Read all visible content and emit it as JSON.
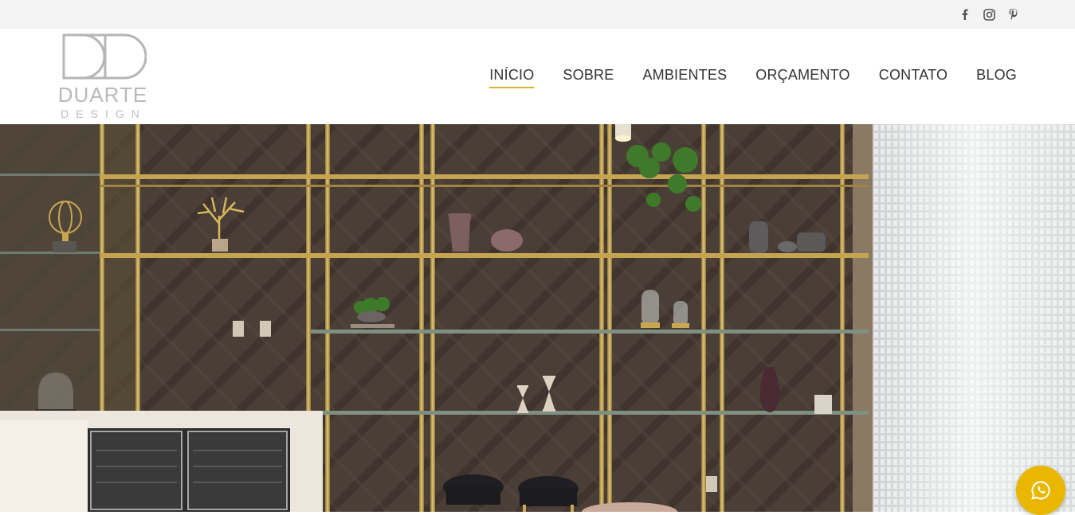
{
  "social": {
    "icons": [
      "facebook-icon",
      "instagram-icon",
      "pinterest-icon"
    ]
  },
  "logo": {
    "name": "DUARTE",
    "sub": "DESIGN"
  },
  "nav": {
    "items": [
      "INÍCIO",
      "SOBRE",
      "AMBIENTES",
      "ORÇAMENTO",
      "CONTATO",
      "BLOG"
    ],
    "active": "INÍCIO"
  },
  "hero": {
    "description_icon": "interior-photo"
  },
  "whatsapp": {
    "icon": "whatsapp-icon",
    "color": "#e9b600"
  },
  "colors": {
    "accent": "#d4b33a",
    "topbar": "#f3f3f3",
    "gold": "#c9a650"
  }
}
